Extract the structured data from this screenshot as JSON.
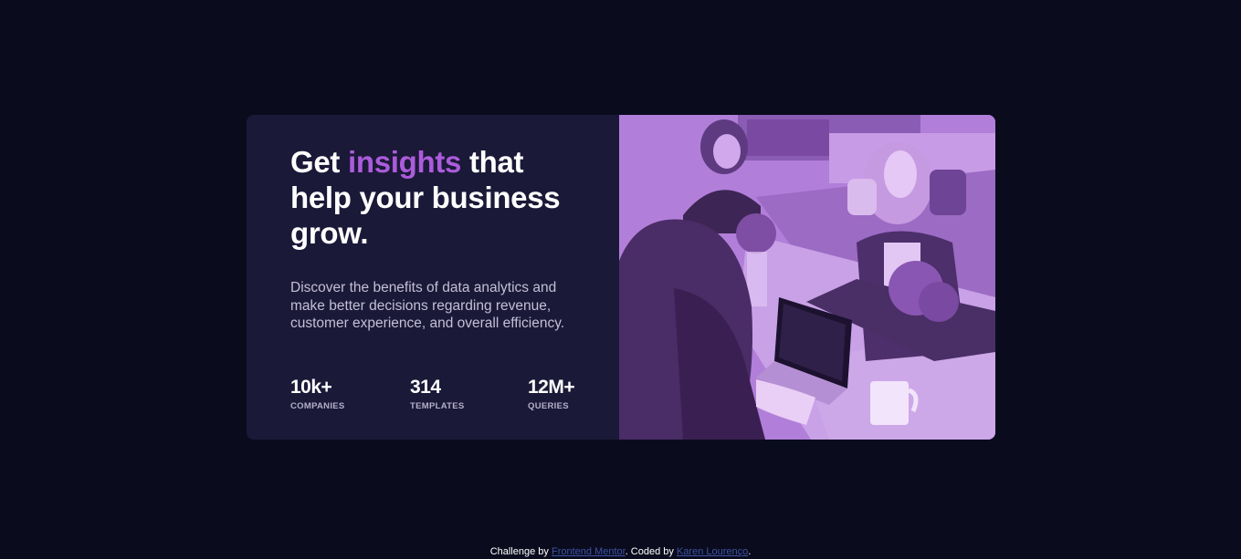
{
  "card": {
    "headline": {
      "before": "Get ",
      "accent": "insights",
      "after": " that help your business grow."
    },
    "description": "Discover the benefits of data analytics and make better decisions regarding revenue, customer experience, and overall efficiency.",
    "stats": [
      {
        "value": "10k+",
        "label": "COMPANIES"
      },
      {
        "value": "314",
        "label": "TEMPLATES"
      },
      {
        "value": "12M+",
        "label": "QUERIES"
      }
    ]
  },
  "footer": {
    "prefix": "Challenge by ",
    "link1": "Frontend Mentor",
    "middle": ". Coded by ",
    "link2": "Karen Lourenço",
    "suffix": "."
  },
  "colors": {
    "background": "#0a0c1e",
    "card": "#1b1938",
    "accent": "#ab5cdb",
    "image_overlay": "#aa5cdb",
    "link": "#3e52a3"
  }
}
